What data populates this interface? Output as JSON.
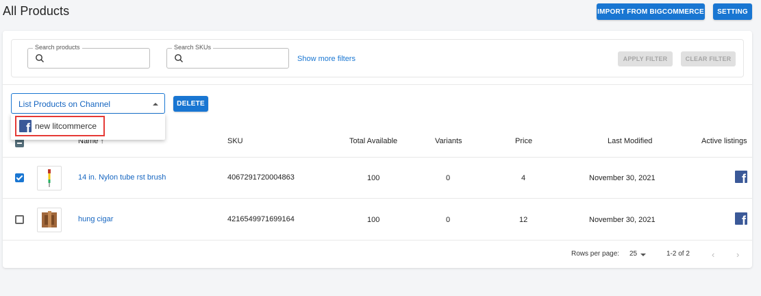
{
  "header": {
    "title": "All Products",
    "import_label": "IMPORT FROM BIGCOMMERCE",
    "setting_label": "SETTING"
  },
  "filters": {
    "search_products_label": "Search products",
    "search_skus_label": "Search SKUs",
    "show_more_label": "Show more filters",
    "apply_label": "APPLY FILTER",
    "clear_label": "CLEAR FILTER"
  },
  "actions": {
    "select_value": "List Products on Channel",
    "delete_label": "DELETE",
    "dropdown_options": [
      "new litcommerce"
    ]
  },
  "table": {
    "columns": [
      "Name",
      "SKU",
      "Total Available",
      "Variants",
      "Price",
      "Last Modified",
      "Active listings"
    ],
    "sort_indicator": "↑",
    "rows": [
      {
        "name": "14 in. Nylon tube rst brush",
        "sku": "4067291720004863",
        "total": "100",
        "variants": "0",
        "price": "4",
        "modified": "November 30, 2021",
        "checked": true,
        "thumb": "brush-thumbnail"
      },
      {
        "name": "hung cigar",
        "sku": "4216549971699164",
        "total": "100",
        "variants": "0",
        "price": "12",
        "modified": "November 30, 2021",
        "checked": false,
        "thumb": "cigar-thumbnail"
      }
    ]
  },
  "pagination": {
    "rows_per_page_label": "Rows per page:",
    "rows_per_page_value": "25",
    "range": "1-2 of 2",
    "prev_icon": "‹",
    "next_icon": "›"
  },
  "icons": {
    "facebook": "f"
  },
  "colors": {
    "primary": "#1976d2",
    "facebook": "#3b5998",
    "highlight": "#e53935"
  }
}
